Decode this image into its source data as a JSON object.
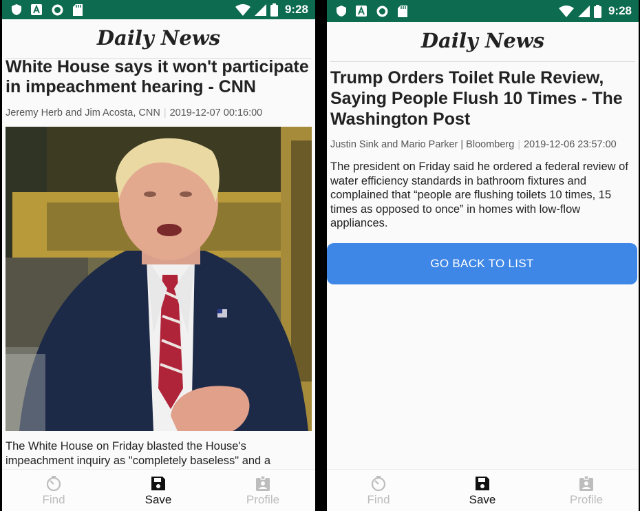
{
  "status_bar": {
    "time": "9:28"
  },
  "app": {
    "title": "Daily News"
  },
  "left": {
    "article": {
      "title": "White House says it won't participate in impeachment hearing - CNN",
      "author": "Jeremy Herb and Jim Acosta, CNN",
      "date": "2019-12-07 00:16:00",
      "body": "The White House on Friday blasted the House's impeachment inquiry as \"completely baseless\" and a"
    }
  },
  "right": {
    "article": {
      "title": "Trump Orders Toilet Rule Review, Saying People Flush 10 Times - The Washington Post",
      "author": "Justin Sink and Mario Parker | Bloomberg",
      "date": "2019-12-06 23:57:00",
      "body": "The president on Friday said he ordered a federal review of water efficiency standards in bathroom fixtures and complained that “people are flushing toilets 10 times, 15 times as opposed to once” in homes with low-flow appliances."
    },
    "back_button": "GO BACK TO LIST"
  },
  "nav": {
    "items": [
      {
        "label": "Find",
        "icon": "timer-icon",
        "active": false
      },
      {
        "label": "Save",
        "icon": "save-icon",
        "active": true
      },
      {
        "label": "Profile",
        "icon": "badge-icon",
        "active": false
      }
    ]
  },
  "colors": {
    "status_bar": "#0d6b50",
    "button": "#3f87e6",
    "inactive": "#bdbdbd"
  }
}
